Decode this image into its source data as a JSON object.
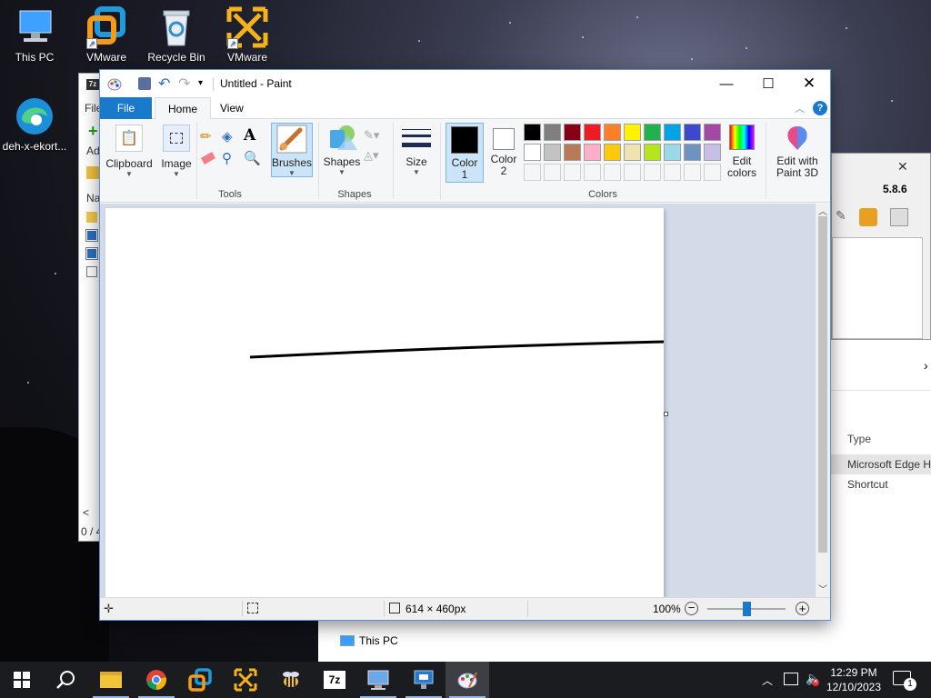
{
  "desktop": {
    "icons": [
      {
        "label": "This PC",
        "icon": "monitor-icon"
      },
      {
        "label": "VMware",
        "icon": "vmware-workstation-icon"
      },
      {
        "label": "Recycle Bin",
        "icon": "recycle-bin-icon"
      },
      {
        "label": "VMware",
        "icon": "vmware-vsphere-icon"
      },
      {
        "label": "deh-x-ekort...",
        "icon": "edge-icon"
      }
    ]
  },
  "bg_window_7zip": {
    "menu_file": "File",
    "add_label": "Ad",
    "name_header": "Na",
    "status": "0 / 4"
  },
  "bg_window_right": {
    "version": "5.8.6",
    "type_header": "Type",
    "rows": [
      "Microsoft Edge H",
      "Shortcut"
    ],
    "nav_item": "This PC"
  },
  "paint": {
    "title": "Untitled - Paint",
    "tabs": {
      "file": "File",
      "home": "Home",
      "view": "View"
    },
    "ribbon": {
      "clipboard": "Clipboard",
      "image": "Image",
      "tools_group": "Tools",
      "brushes": "Brushes",
      "shapes": "Shapes",
      "shapes_group": "Shapes",
      "size": "Size",
      "color1_line1": "Color",
      "color1_line2": "1",
      "color2_line1": "Color",
      "color2_line2": "2",
      "colors_group": "Colors",
      "edit_colors_line1": "Edit",
      "edit_colors_line2": "colors",
      "paint3d_line1": "Edit with",
      "paint3d_line2": "Paint 3D"
    },
    "palette_row1": [
      "#000000",
      "#7f7f7f",
      "#880015",
      "#ed1c24",
      "#ff7f27",
      "#fff200",
      "#22b14c",
      "#00a2e8",
      "#3f48cc",
      "#a349a4"
    ],
    "palette_row2": [
      "#ffffff",
      "#c3c3c3",
      "#b97a57",
      "#ffaec9",
      "#ffc90e",
      "#efe4b0",
      "#b5e61d",
      "#99d9ea",
      "#7092be",
      "#c8bfe7"
    ],
    "color1": "#000000",
    "color2": "#ffffff",
    "status": {
      "dimensions": "614 × 460px",
      "zoom": "100%",
      "zoom_fraction": 0.5
    }
  },
  "taskbar": {
    "time": "12:29 PM",
    "date": "12/10/2023",
    "notification_count": "1",
    "apps": [
      "file-explorer-icon",
      "chrome-icon",
      "vmware-workstation-icon",
      "vmware-vsphere-icon",
      "bee-icon",
      "7zip-icon",
      "remote-desktop-icon",
      "network-manager-icon",
      "paint-icon"
    ]
  }
}
